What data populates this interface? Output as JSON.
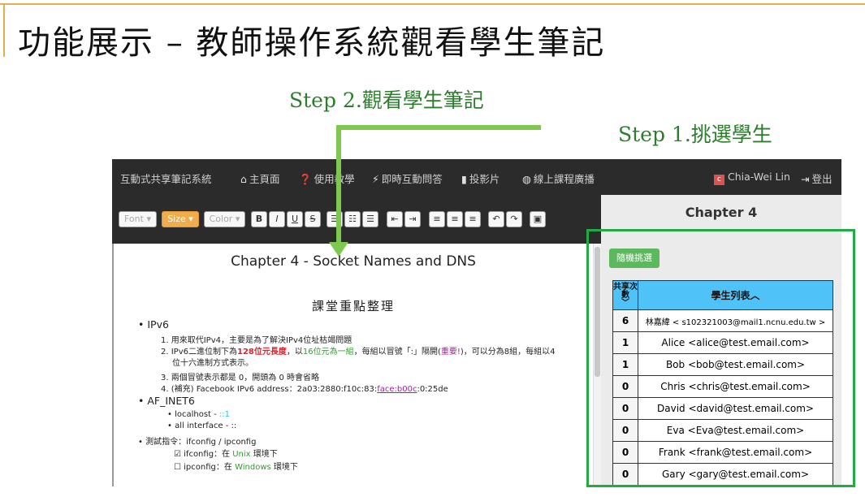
{
  "slide": {
    "title": "功能展示 – 教師操作系統觀看學生筆記",
    "step2": "Step 2.觀看學生筆記",
    "step1": "Step 1.挑選學生"
  },
  "nav": {
    "brand": "互動式共享筆記系統",
    "items": [
      {
        "icon": "home-icon",
        "glyph": "🏠",
        "label": "主頁面"
      },
      {
        "icon": "question-circle-icon",
        "glyph": "❓",
        "label": "使用教學"
      },
      {
        "icon": "bolt-icon",
        "glyph": "⚡",
        "label": "即時互動問答"
      },
      {
        "icon": "file-icon",
        "glyph": "🗋",
        "label": "投影片"
      },
      {
        "icon": "globe-icon",
        "glyph": "🌐",
        "label": "線上課程廣播"
      }
    ],
    "user": "Chia-Wei Lin",
    "user_initial": "c",
    "logout": "登出"
  },
  "toolbar": {
    "font": "Font",
    "size": "Size",
    "color": "Color",
    "bold": "B",
    "italic": "I",
    "underline": "U",
    "strike": "S"
  },
  "editor": {
    "title": "Chapter 4 - Socket Names and DNS",
    "subtitle": "課堂重點整理",
    "ipv6": "IPv6",
    "l1": "1. 用來取代IPv4，主要是為了解決IPv4位址枯竭問題",
    "l2a": "2. IPv6二進位制下為",
    "l2b": "128位元長度",
    "l2c": "，以",
    "l2d": "16位元為一組",
    "l2e": "，每組以冒號「:」隔開(",
    "l2f": "重要!",
    "l2g": ")，可以分為8組，每組以4",
    "l2h": "位十六進制方式表示。",
    "l3": "3.  兩個冒號表示都是 0，開頭為 0 時會省略",
    "l4a": "4.  (補充) Facebook IPv6 address：2a03:2880:f10c:83:",
    "l4b": "face:b00c",
    "l4c": ":0:25de",
    "af": "AF_INET6",
    "lh": "localhost  - ",
    "lh2": "::1",
    "ai": "all interface - ::",
    "cmd": "測試指令：ifconfig / ipconfig",
    "if1a": "☑ ifconfig：在 ",
    "if1b": "Unix",
    "if1c": " 環境下",
    "if2a": "☐ ipconfig：在 ",
    "if2b": "Windows",
    "if2c": " 環境下"
  },
  "panel": {
    "chapter": "Chapter 4",
    "random_button": "隨機挑選",
    "col_count": "共享次數",
    "col_students": "學生列表",
    "students": [
      {
        "count": "6",
        "name": "林嘉緯 < s102321003@mail1.ncnu.edu.tw >"
      },
      {
        "count": "1",
        "name": "Alice <alice@test.email.com>"
      },
      {
        "count": "1",
        "name": "Bob <bob@test.email.com>"
      },
      {
        "count": "0",
        "name": "Chris <chris@test.email.com>"
      },
      {
        "count": "0",
        "name": "David <david@test.email.com>"
      },
      {
        "count": "0",
        "name": "Eva <Eva@test.email.com>"
      },
      {
        "count": "0",
        "name": "Frank <frank@test.email.com>"
      },
      {
        "count": "0",
        "name": "Gary <gary@test.email.com>"
      }
    ]
  },
  "colors": {
    "accent_green": "#7ec850",
    "highlight_box": "#22aa44",
    "header_blue": "#4fc3f7",
    "navbar": "#2b2b2b"
  }
}
